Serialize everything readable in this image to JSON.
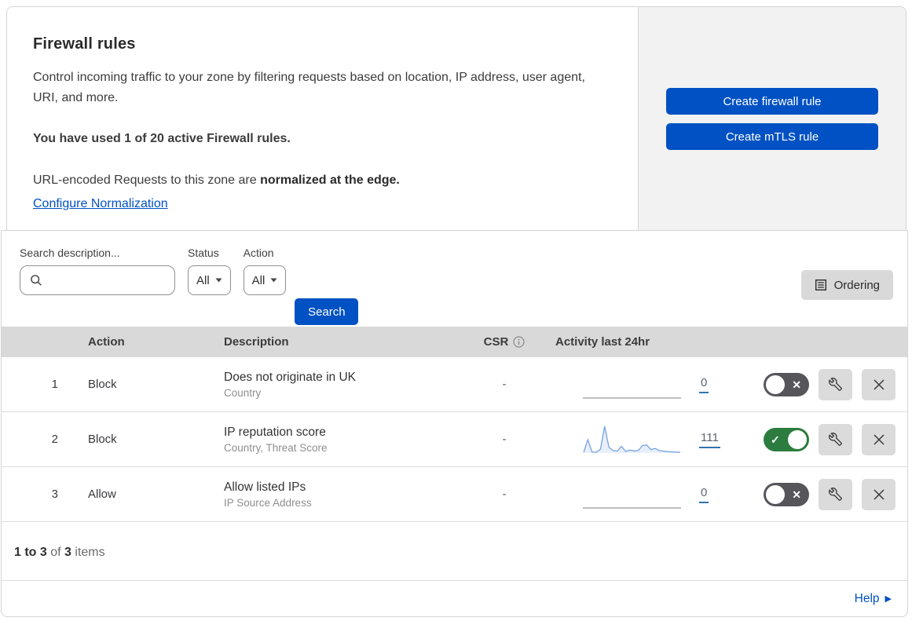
{
  "header": {
    "title": "Firewall rules",
    "description": "Control incoming traffic to your zone by filtering requests based on location, IP address, user agent, URI, and more.",
    "usage": "You have used 1 of 20 active Firewall rules.",
    "normalization_prefix": "URL-encoded Requests to this zone are ",
    "normalization_bold": "normalized at the edge.",
    "configure_link": "Configure Normalization",
    "buttons": {
      "create_firewall": "Create firewall rule",
      "create_mtls": "Create mTLS rule"
    }
  },
  "filters": {
    "search_label": "Search description...",
    "status_label": "Status",
    "status_value": "All",
    "action_label": "Action",
    "action_value": "All",
    "search_button": "Search",
    "ordering_button": "Ordering"
  },
  "table": {
    "columns": [
      "Action",
      "Description",
      "CSR",
      "Activity last 24hr"
    ],
    "rows": [
      {
        "priority": "1",
        "action": "Block",
        "description": "Does not originate in UK",
        "fields": "Country",
        "csr": "-",
        "activity_count": "0",
        "enabled": false,
        "sparkline": [
          0,
          0,
          0,
          0,
          0,
          0,
          0,
          0,
          0,
          0,
          0,
          0,
          0,
          0,
          0,
          0,
          0,
          0,
          0,
          0,
          0,
          0,
          0,
          0
        ]
      },
      {
        "priority": "2",
        "action": "Block",
        "description": "IP reputation score",
        "fields": "Country, Threat Score",
        "csr": "-",
        "activity_count": "111",
        "enabled": true,
        "sparkline": [
          2,
          50,
          4,
          3,
          14,
          100,
          22,
          9,
          7,
          25,
          6,
          11,
          8,
          9,
          28,
          30,
          13,
          17,
          9,
          7,
          5,
          4,
          3,
          3
        ]
      },
      {
        "priority": "3",
        "action": "Allow",
        "description": "Allow listed IPs",
        "fields": "IP Source Address",
        "csr": "-",
        "activity_count": "0",
        "enabled": false,
        "sparkline": [
          0,
          0,
          0,
          0,
          0,
          0,
          0,
          0,
          0,
          0,
          0,
          0,
          0,
          0,
          0,
          0,
          0,
          0,
          0,
          0,
          0,
          0,
          0,
          0
        ]
      }
    ]
  },
  "footer": {
    "range": "1 to 3",
    "of": " of ",
    "total": "3",
    "items": " items",
    "help_label": "Help"
  },
  "colors": {
    "accent_blue": "#0051c3",
    "toggle_on_green": "#2c7c3f",
    "toggle_off_gray": "#55555a",
    "sparkline_blue": "#74a3e3",
    "sparkline_fill": "#e8effa",
    "flat_line_gray": "#9b9b9b",
    "table_header_gray": "#d9d9d9",
    "panel_gray": "#f2f2f2"
  }
}
